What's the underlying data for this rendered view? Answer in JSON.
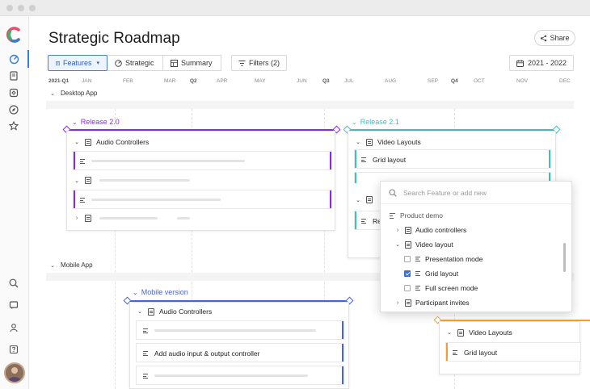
{
  "app": {
    "title": "Strategic Roadmap",
    "share_label": "Share"
  },
  "views": {
    "tabs": [
      {
        "label": "Features",
        "active": true
      },
      {
        "label": "Strategic"
      },
      {
        "label": "Summary"
      }
    ],
    "filters_label": "Filters (2)",
    "date_range": "2021 - 2022"
  },
  "timeline": {
    "labels": [
      "2021-Q1",
      "JAN",
      "FEB",
      "MAR",
      "Q2",
      "APR",
      "MAY",
      "JUN",
      "Q3",
      "JUL",
      "AUG",
      "SEP",
      "Q4",
      "OCT",
      "NOV",
      "DEC"
    ]
  },
  "sections": {
    "desktop": "Desktop App",
    "mobile": "Mobile App"
  },
  "releases": {
    "r20": {
      "label": "Release 2.0",
      "color": "#8a2be2",
      "card_title": "Audio Controllers"
    },
    "r21": {
      "label": "Release 2.1",
      "color": "#3fbfbf",
      "card_title": "Video Layouts",
      "row1": "Grid layout",
      "row_partial": "Re"
    },
    "mobile": {
      "label": "Mobile version",
      "color": "#4a63d8",
      "card_title": "Audio Controllers",
      "row2": "Add audio input & output controller"
    },
    "orange": {
      "color": "#f0a030",
      "card_title": "Video Layouts",
      "row1": "Grid layout"
    }
  },
  "popup": {
    "search_placeholder": "Search Feature or add new",
    "product": "Product demo",
    "items": [
      {
        "label": "Audio controllers"
      },
      {
        "label": "Video layout"
      },
      {
        "label": "Presentation mode",
        "checked": false
      },
      {
        "label": "Grid layout",
        "checked": true
      },
      {
        "label": "Full screen mode",
        "checked": false
      },
      {
        "label": "Participant invites"
      }
    ]
  },
  "colors": {
    "accent": "#3a7bd5",
    "purple": "#8a2be2",
    "teal": "#3fbfbf",
    "blue": "#4a63d8",
    "orange": "#f0a030"
  }
}
